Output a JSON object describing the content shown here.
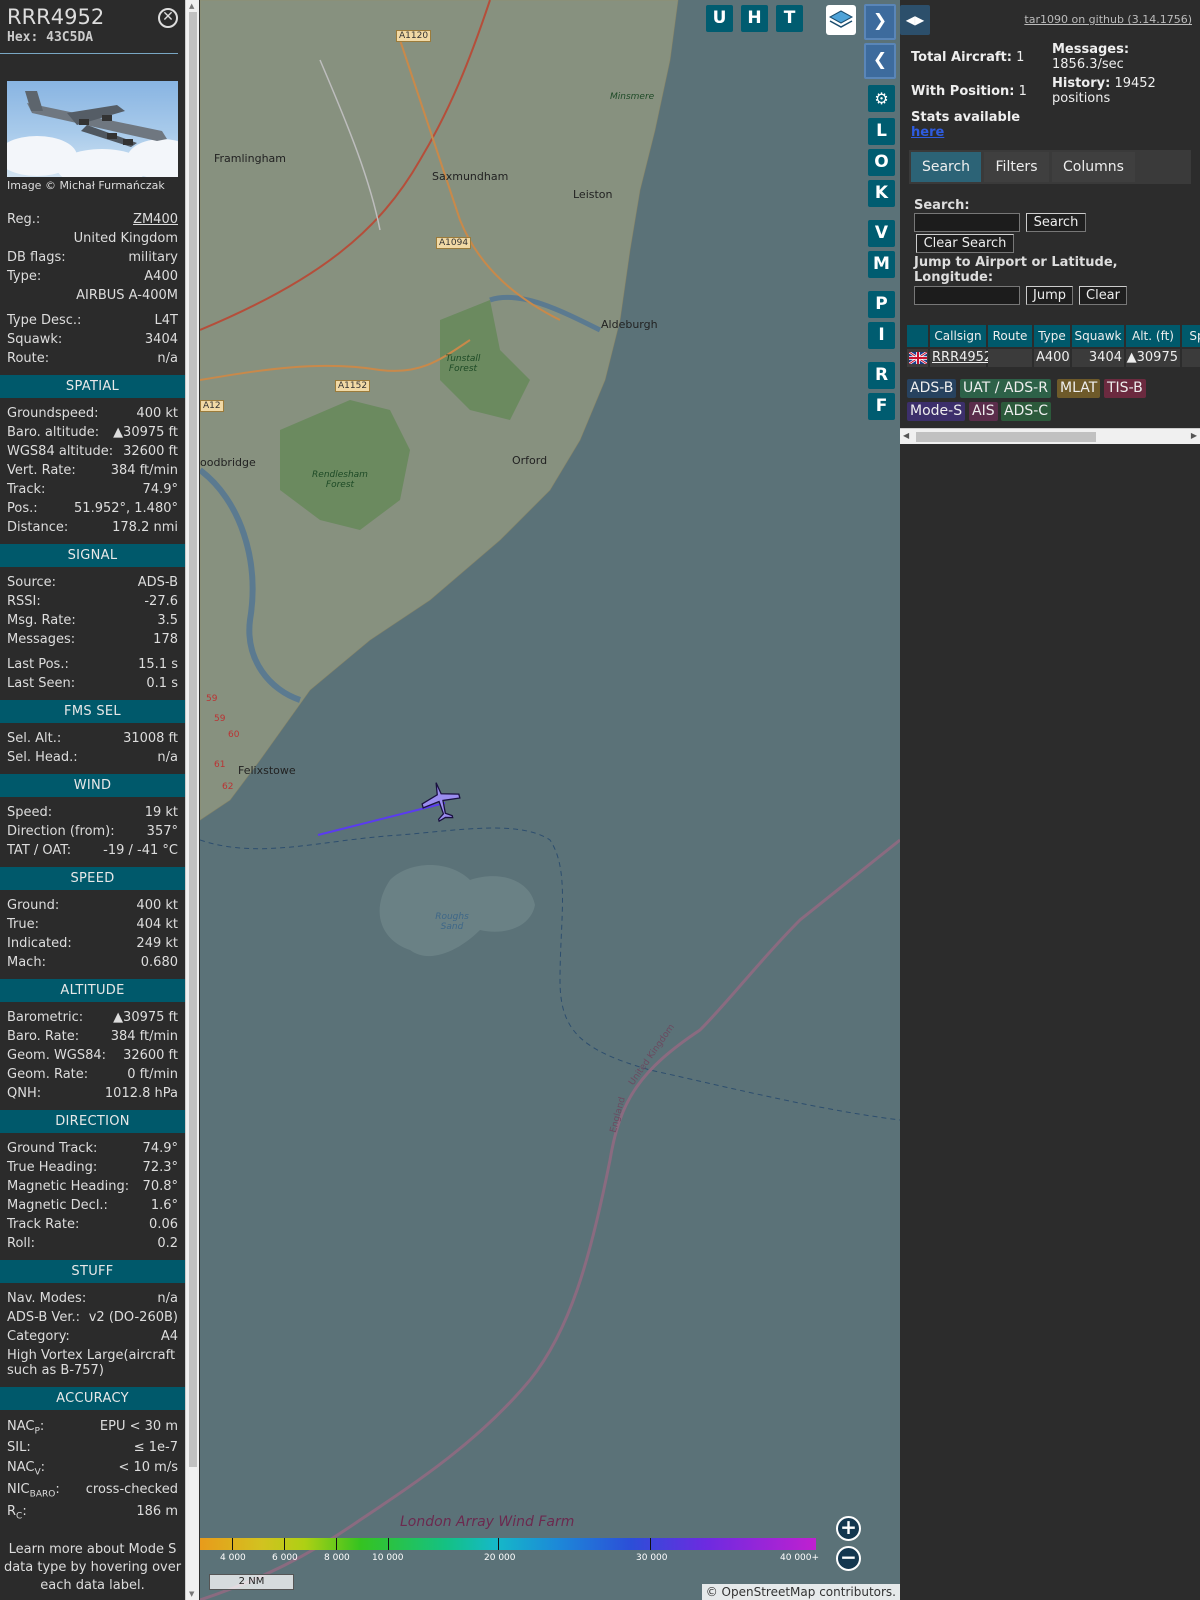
{
  "aircraft": {
    "callsign": "RRR4952",
    "hex": "Hex: 43C5DA",
    "photo_credit": "Image © Michał Furmańczak",
    "registration": {
      "label": "Reg.:",
      "value": "ZM400"
    },
    "country": "United Kingdom",
    "db_flags": {
      "label": "DB flags:",
      "value": "military"
    },
    "type": {
      "label": "Type:",
      "value": "A400"
    },
    "type_full": "AIRBUS A-400M",
    "type_desc": {
      "label": "Type Desc.:",
      "value": "L4T"
    },
    "squawk": {
      "label": "Squawk:",
      "value": "3404"
    },
    "route": {
      "label": "Route:",
      "value": "n/a"
    }
  },
  "sections": {
    "spatial": {
      "title": "SPATIAL",
      "groundspeed": {
        "label": "Groundspeed:",
        "value": "400 kt"
      },
      "baro_alt": {
        "label": "Baro. altitude:",
        "value": "▲30975 ft"
      },
      "wgs84_alt": {
        "label": "WGS84 altitude:",
        "value": "32600 ft"
      },
      "vert_rate": {
        "label": "Vert. Rate:",
        "value": "384 ft/min"
      },
      "track": {
        "label": "Track:",
        "value": "74.9°"
      },
      "pos": {
        "label": "Pos.:",
        "value": "51.952°, 1.480°"
      },
      "distance": {
        "label": "Distance:",
        "value": "178.2 nmi"
      }
    },
    "signal": {
      "title": "SIGNAL",
      "source": {
        "label": "Source:",
        "value": "ADS-B"
      },
      "rssi": {
        "label": "RSSI:",
        "value": "-27.6"
      },
      "msg_rate": {
        "label": "Msg. Rate:",
        "value": "3.5"
      },
      "messages": {
        "label": "Messages:",
        "value": "178"
      },
      "last_pos": {
        "label": "Last Pos.:",
        "value": "15.1 s"
      },
      "last_seen": {
        "label": "Last Seen:",
        "value": "0.1 s"
      }
    },
    "fms": {
      "title": "FMS SEL",
      "sel_alt": {
        "label": "Sel. Alt.:",
        "value": "31008 ft"
      },
      "sel_head": {
        "label": "Sel. Head.:",
        "value": "n/a"
      }
    },
    "wind": {
      "title": "WIND",
      "speed": {
        "label": "Speed:",
        "value": "19 kt"
      },
      "direction": {
        "label": "Direction (from):",
        "value": "357°"
      },
      "tat_oat": {
        "label": "TAT / OAT:",
        "value": "-19 / -41 °C"
      }
    },
    "speed": {
      "title": "SPEED",
      "ground": {
        "label": "Ground:",
        "value": "400 kt"
      },
      "true": {
        "label": "True:",
        "value": "404 kt"
      },
      "indicated": {
        "label": "Indicated:",
        "value": "249 kt"
      },
      "mach": {
        "label": "Mach:",
        "value": "0.680"
      }
    },
    "altitude": {
      "title": "ALTITUDE",
      "barometric": {
        "label": "Barometric:",
        "value": "▲30975 ft"
      },
      "baro_rate": {
        "label": "Baro. Rate:",
        "value": "384 ft/min"
      },
      "geom_wgs84": {
        "label": "Geom. WGS84:",
        "value": "32600 ft"
      },
      "geom_rate": {
        "label": "Geom. Rate:",
        "value": "0 ft/min"
      },
      "qnh": {
        "label": "QNH:",
        "value": "1012.8 hPa"
      }
    },
    "direction": {
      "title": "DIRECTION",
      "ground_track": {
        "label": "Ground Track:",
        "value": "74.9°"
      },
      "true_heading": {
        "label": "True Heading:",
        "value": "72.3°"
      },
      "mag_heading": {
        "label": "Magnetic Heading:",
        "value": "70.8°"
      },
      "mag_decl": {
        "label": "Magnetic Decl.:",
        "value": "1.6°"
      },
      "track_rate": {
        "label": "Track Rate:",
        "value": "0.06"
      },
      "roll": {
        "label": "Roll:",
        "value": "0.2"
      }
    },
    "stuff": {
      "title": "STUFF",
      "nav_modes": {
        "label": "Nav. Modes:",
        "value": "n/a"
      },
      "adsb_ver": {
        "label": "ADS-B Ver.:",
        "value": "v2 (DO-260B)"
      },
      "category": {
        "label": "Category:",
        "value": "A4"
      },
      "category_desc": "High Vortex Large(aircraft such as B-757)"
    },
    "accuracy": {
      "title": "ACCURACY",
      "nacp": {
        "label": "NAC",
        "sub": "P",
        "value": "EPU < 30 m"
      },
      "sil": {
        "label": "SIL:",
        "value": "≤ 1e-7"
      },
      "nacv": {
        "label": "NAC",
        "sub": "V",
        "value": "< 10 m/s"
      },
      "nicbaro": {
        "label": "NIC",
        "sub": "BARO",
        "value": "cross-checked"
      },
      "rc": {
        "label": "R",
        "sub": "C",
        "value": "186 m"
      }
    },
    "footnote": "Learn more about Mode S data type by hovering over each data label."
  },
  "map": {
    "buttons_top": [
      "U",
      "H",
      "T"
    ],
    "buttons_side": [
      "L",
      "O",
      "K",
      "V",
      "M",
      "P",
      "I",
      "R",
      "F"
    ],
    "places": [
      "Framlingham",
      "Saxmundham",
      "Leiston",
      "Aldeburgh",
      "oodbridge",
      "Orford",
      "Felixstowe",
      "Minsmere"
    ],
    "roads": [
      "A1120",
      "A1094",
      "A1152",
      "A12"
    ],
    "forests": [
      "Tunstall Forest",
      "Rendlesham Forest"
    ],
    "sea": [
      "Roughs Sand"
    ],
    "road_numbers": [
      "59",
      "59",
      "60",
      "61",
      "62"
    ],
    "border_labels": [
      "United Kingdom",
      "England"
    ],
    "bottom_label": "London Array Wind Farm",
    "altitude_legend": [
      "4 000",
      "6 000",
      "8 000",
      "10 000",
      "20 000",
      "30 000",
      "40 000+"
    ],
    "scale": "2 NM",
    "attribution_prefix": "© ",
    "attribution_link": "OpenStreetMap",
    "attribution_suffix": " contributors.",
    "zoom_in": "+",
    "zoom_out": "−"
  },
  "sidebar": {
    "github": "tar1090 on github (3.14.1756)",
    "total_aircraft": {
      "label": "Total Aircraft:",
      "value": "1"
    },
    "with_position": {
      "label": "With Position:",
      "value": "1"
    },
    "messages": {
      "label": "Messages:",
      "value": "1856.3/sec"
    },
    "history": {
      "label": "History:",
      "value": "19452 positions"
    },
    "stats_text": "Stats available",
    "stats_link": "here",
    "tabs": [
      "Search",
      "Filters",
      "Columns"
    ],
    "search_label": "Search:",
    "search_button": "Search",
    "clear_search_button": "Clear Search",
    "jump_label": "Jump to Airport or Latitude, Longitude:",
    "jump_button": "Jump",
    "clear_button": "Clear",
    "table": {
      "headers": [
        "Callsign",
        "Route",
        "Type",
        "Squawk",
        "Alt. (ft)",
        "Sp"
      ],
      "row": {
        "callsign": "RRR4952",
        "route": "",
        "type": "A400",
        "squawk": "3404",
        "alt": "▲30975"
      }
    },
    "source_tags": [
      "ADS-B",
      "UAT / ADS-R",
      "MLAT",
      "TIS-B",
      "Mode-S",
      "AIS",
      "ADS-C"
    ],
    "tag_colors": {
      "ADS-B": "#27425f",
      "UAT / ADS-R": "#2d6148",
      "MLAT": "#6e5a2a",
      "TIS-B": "#6b2a3f",
      "Mode-S": "#3c2f6b",
      "AIS": "#5b2d4b",
      "ADS-C": "#2c5a3b"
    }
  }
}
